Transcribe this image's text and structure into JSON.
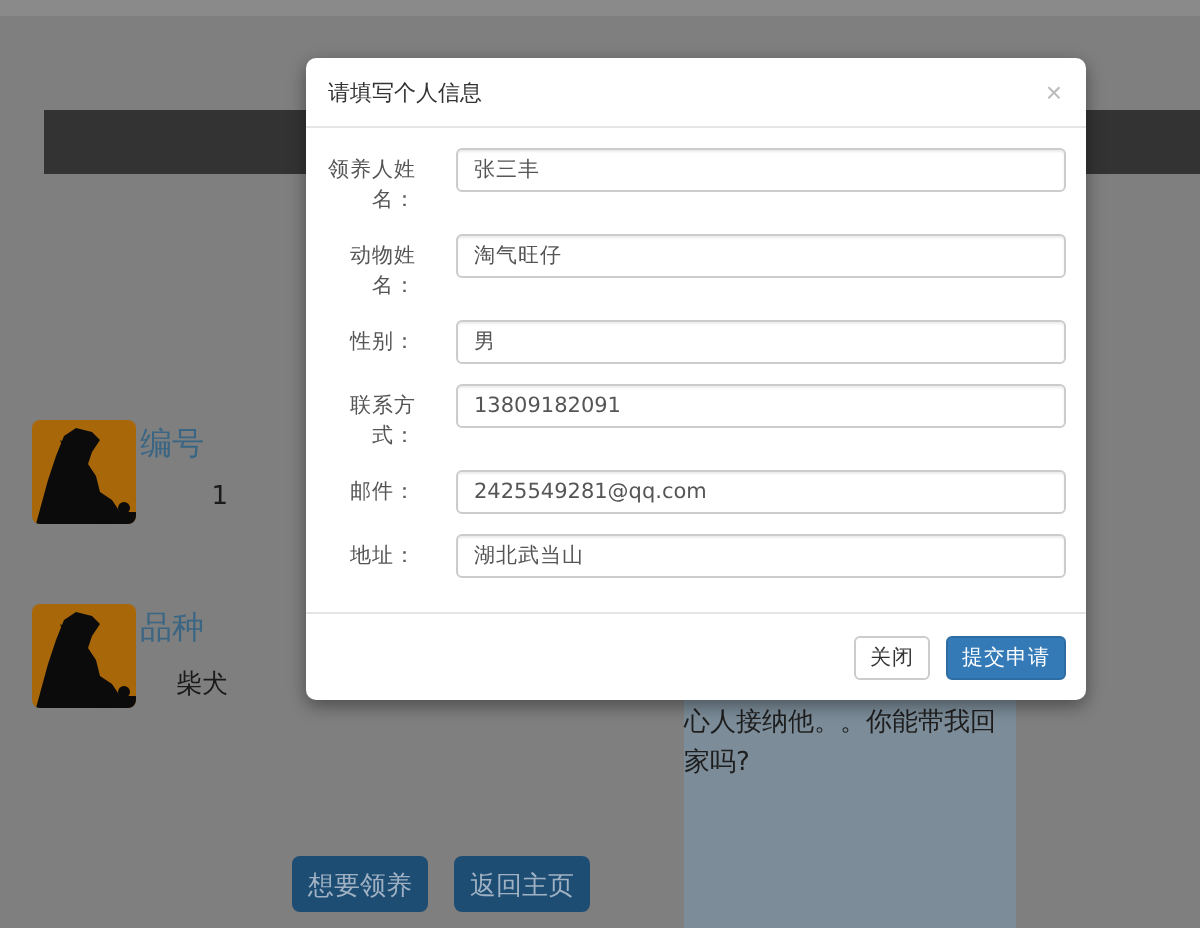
{
  "cards": [
    {
      "label": "编号",
      "value": "1"
    },
    {
      "label": "品种",
      "value": "柴犬"
    }
  ],
  "story": "心人接纳他。。你能带我回家吗?",
  "actions": [
    "想要领养",
    "返回主页"
  ],
  "dialog": {
    "title": "请填写个人信息",
    "close": "×",
    "fields": [
      {
        "label": "领养人姓名：",
        "value": "张三丰"
      },
      {
        "label": "动物姓名：",
        "value": "淘气旺仔"
      },
      {
        "label": "性别：",
        "value": "男"
      },
      {
        "label": "联系方式：",
        "value": "13809182091"
      },
      {
        "label": "邮件：",
        "value": "2425549281@qq.com"
      },
      {
        "label": "地址：",
        "value": "湖北武当山"
      }
    ],
    "buttons": [
      {
        "label": "关闭",
        "kind": "default"
      },
      {
        "label": "提交申请",
        "kind": "primary"
      }
    ]
  }
}
